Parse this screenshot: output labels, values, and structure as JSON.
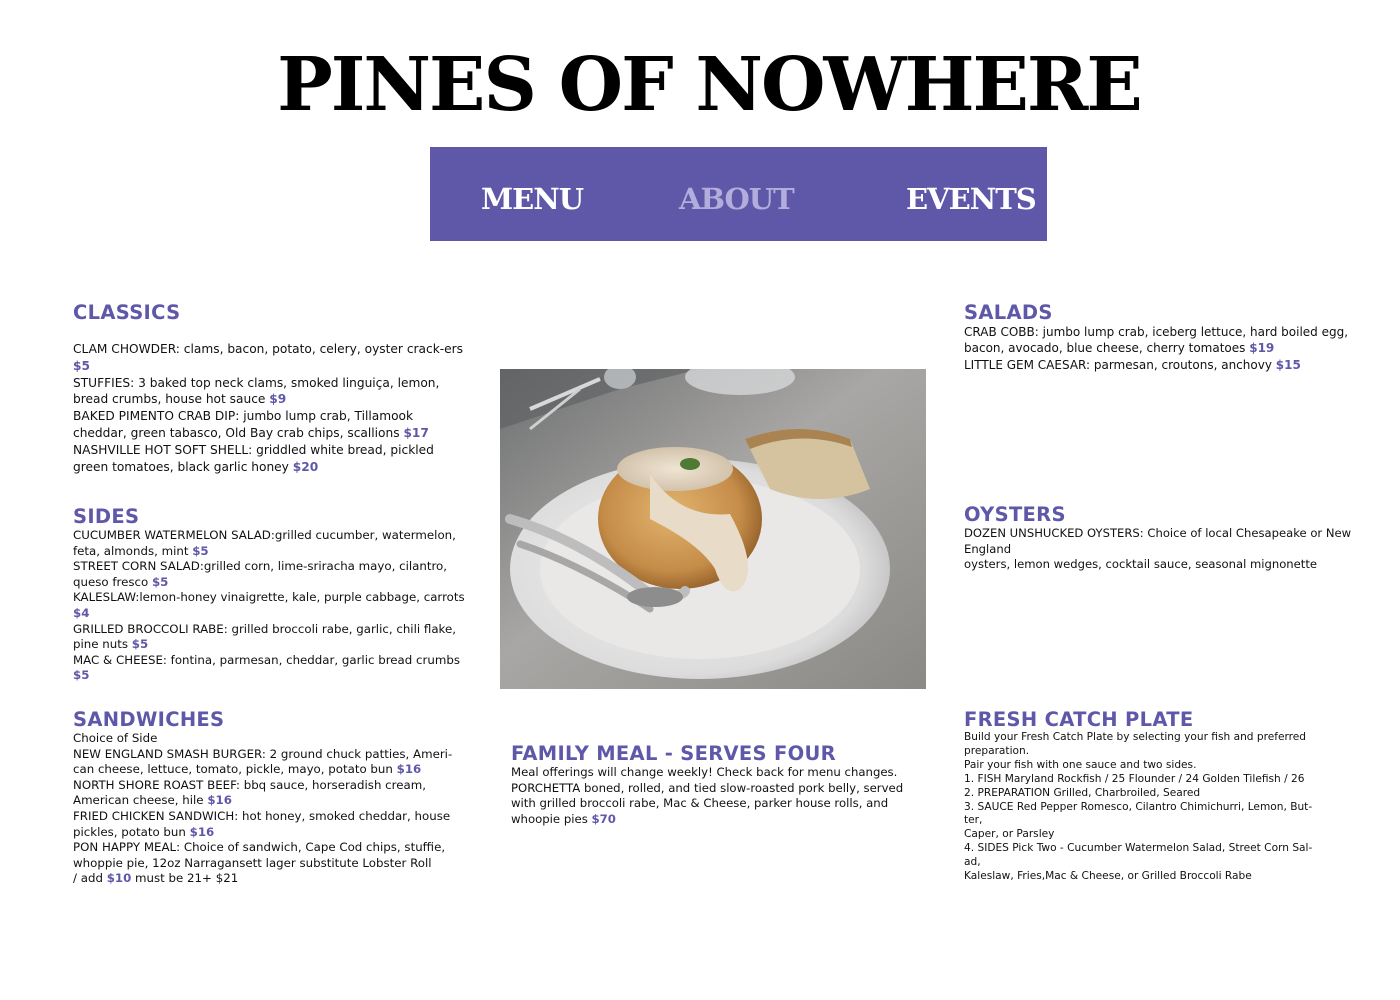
{
  "site": {
    "title": "PINES OF NOWHERE"
  },
  "nav": {
    "items": [
      "MENU",
      "ABOUT",
      "EVENTS"
    ],
    "active": "ABOUT",
    "bg_color": "#5f58a8",
    "active_color": "#b2addb"
  },
  "colors": {
    "accent": "#5f58a8"
  },
  "classics": {
    "title": "CLASSICS",
    "items": [
      {
        "name": "CLAM CHOWDER:",
        "desc": " clams, bacon, potato, celery, oyster crack-ers ",
        "price": "$5"
      },
      {
        "name": "STUFFIES:",
        "desc": " 3 baked top neck clams, smoked linguiça, lemon, bread crumbs, house hot sauce ",
        "price": "$9"
      },
      {
        "name": "BAKED PIMENTO CRAB DIP:",
        "desc": " jumbo lump crab, Tillamook cheddar, green tabasco, Old Bay crab chips, scallions ",
        "price": "$17"
      },
      {
        "name": "NASHVILLE HOT SOFT SHELL:",
        "desc": " griddled white bread, pickled green tomatoes, black garlic honey ",
        "price": "$20"
      }
    ]
  },
  "sides": {
    "title": "SIDES",
    "items": [
      {
        "name": "CUCUMBER WATERMELON SALAD:",
        "desc": "grilled cucumber, watermelon, feta, almonds, mint ",
        "price": "$5"
      },
      {
        "name": "STREET CORN SALAD:",
        "desc": "grilled corn, lime-sriracha mayo, cilantro, queso fresco ",
        "price": "$5"
      },
      {
        "name": "KALESLAW:",
        "desc": "lemon-honey vinaigrette, kale, purple cabbage, carrots ",
        "price": "$4"
      },
      {
        "name": "GRILLED BROCCOLI RABE:",
        "desc": " grilled broccoli rabe, garlic, chili flake, pine nuts ",
        "price": "$5"
      },
      {
        "name": "MAC & CHEESE:",
        "desc": " fontina, parmesan, cheddar, garlic bread crumbs ",
        "price": "$5"
      }
    ]
  },
  "sandwiches": {
    "title": "SANDWICHES",
    "intro": "Choice of Side",
    "items": [
      {
        "name": "NEW ENGLAND SMASH BURGER:",
        "desc": " 2 ground chuck patties, Ameri-can cheese, lettuce, tomato, pickle, mayo, potato bun ",
        "price": "$16"
      },
      {
        "name": "NORTH SHORE ROAST BEEF:",
        "desc": " bbq sauce, horseradish cream, American cheese, hile ",
        "price": "$16"
      },
      {
        "name": "FRIED CHICKEN SANDWICH:",
        "desc": " hot honey, smoked cheddar, house pickles, potato bun ",
        "price": "$16"
      },
      {
        "name": "PON HAPPY MEAL:",
        "desc": " Choice of sandwich, Cape Cod chips, stuffie, whoppie pie, 12oz Narragansett lager substitute Lobster Roll"
      }
    ],
    "addon": {
      "pre": "/ add ",
      "price": "$10",
      "post": " must be 21+ $21"
    }
  },
  "salads": {
    "title": "SALADS",
    "items": [
      {
        "name": "CRAB COBB:",
        "desc": " jumbo lump crab, iceberg lettuce, hard boiled egg, bacon, avocado, blue cheese, cherry tomatoes ",
        "price": "$19"
      },
      {
        "name": "LITTLE GEM CAESAR:",
        "desc": " parmesan, croutons, anchovy ",
        "price": "$15"
      }
    ]
  },
  "oysters": {
    "title": "OYSTERS",
    "name": "DOZEN UNSHUCKED OYSTERS:",
    "desc": " Choice of local Chesapeake or New England",
    "line2": "oysters, lemon wedges, cocktail sauce, seasonal mignonette"
  },
  "family": {
    "title": "FAMILY MEAL - SERVES FOUR",
    "line1": "Meal offerings will change weekly! Check back for menu changes.",
    "line2": "PORCHETTA boned, rolled, and tied slow-roasted pork belly, served with grilled broccoli rabe, Mac & Cheese, parker house rolls, and whoopie pies ",
    "price": "$70"
  },
  "fresh": {
    "title": "FRESH CATCH PLATE",
    "lines": [
      "Build your Fresh Catch Plate by selecting your fish and preferred preparation.",
      "Pair your fish with one sauce and two sides.",
      "1. FISH Maryland Rockfish / 25 Flounder / 24 Golden Tilefish / 26",
      "2. PREPARATION Grilled, Charbroiled, Seared",
      "3. SAUCE Red Pepper Romesco, Cilantro Chimichurri, Lemon, But-ter,",
      "Caper, or Parsley",
      "4. SIDES Pick Two - Cucumber Watermelon Salad, Street Corn Sal-ad,",
      "Kaleslaw, Fries,Mac & Cheese, or Grilled Broccoli Rabe"
    ]
  },
  "photo": {
    "icon": "clam-chowder-bread-bowl-photo"
  }
}
